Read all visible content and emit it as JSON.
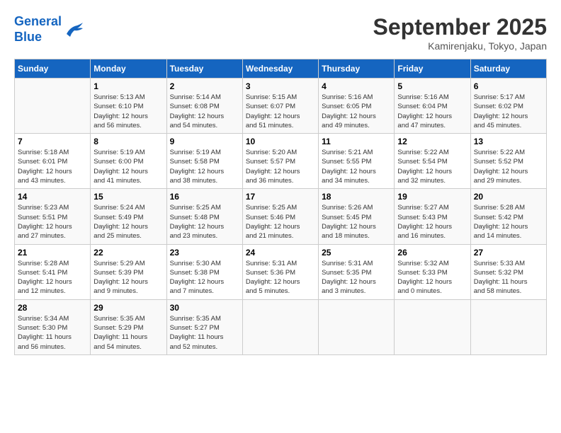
{
  "header": {
    "logo_line1": "General",
    "logo_line2": "Blue",
    "month": "September 2025",
    "location": "Kamirenjaku, Tokyo, Japan"
  },
  "weekdays": [
    "Sunday",
    "Monday",
    "Tuesday",
    "Wednesday",
    "Thursday",
    "Friday",
    "Saturday"
  ],
  "weeks": [
    [
      {
        "num": "",
        "info": ""
      },
      {
        "num": "1",
        "info": "Sunrise: 5:13 AM\nSunset: 6:10 PM\nDaylight: 12 hours\nand 56 minutes."
      },
      {
        "num": "2",
        "info": "Sunrise: 5:14 AM\nSunset: 6:08 PM\nDaylight: 12 hours\nand 54 minutes."
      },
      {
        "num": "3",
        "info": "Sunrise: 5:15 AM\nSunset: 6:07 PM\nDaylight: 12 hours\nand 51 minutes."
      },
      {
        "num": "4",
        "info": "Sunrise: 5:16 AM\nSunset: 6:05 PM\nDaylight: 12 hours\nand 49 minutes."
      },
      {
        "num": "5",
        "info": "Sunrise: 5:16 AM\nSunset: 6:04 PM\nDaylight: 12 hours\nand 47 minutes."
      },
      {
        "num": "6",
        "info": "Sunrise: 5:17 AM\nSunset: 6:02 PM\nDaylight: 12 hours\nand 45 minutes."
      }
    ],
    [
      {
        "num": "7",
        "info": "Sunrise: 5:18 AM\nSunset: 6:01 PM\nDaylight: 12 hours\nand 43 minutes."
      },
      {
        "num": "8",
        "info": "Sunrise: 5:19 AM\nSunset: 6:00 PM\nDaylight: 12 hours\nand 41 minutes."
      },
      {
        "num": "9",
        "info": "Sunrise: 5:19 AM\nSunset: 5:58 PM\nDaylight: 12 hours\nand 38 minutes."
      },
      {
        "num": "10",
        "info": "Sunrise: 5:20 AM\nSunset: 5:57 PM\nDaylight: 12 hours\nand 36 minutes."
      },
      {
        "num": "11",
        "info": "Sunrise: 5:21 AM\nSunset: 5:55 PM\nDaylight: 12 hours\nand 34 minutes."
      },
      {
        "num": "12",
        "info": "Sunrise: 5:22 AM\nSunset: 5:54 PM\nDaylight: 12 hours\nand 32 minutes."
      },
      {
        "num": "13",
        "info": "Sunrise: 5:22 AM\nSunset: 5:52 PM\nDaylight: 12 hours\nand 29 minutes."
      }
    ],
    [
      {
        "num": "14",
        "info": "Sunrise: 5:23 AM\nSunset: 5:51 PM\nDaylight: 12 hours\nand 27 minutes."
      },
      {
        "num": "15",
        "info": "Sunrise: 5:24 AM\nSunset: 5:49 PM\nDaylight: 12 hours\nand 25 minutes."
      },
      {
        "num": "16",
        "info": "Sunrise: 5:25 AM\nSunset: 5:48 PM\nDaylight: 12 hours\nand 23 minutes."
      },
      {
        "num": "17",
        "info": "Sunrise: 5:25 AM\nSunset: 5:46 PM\nDaylight: 12 hours\nand 21 minutes."
      },
      {
        "num": "18",
        "info": "Sunrise: 5:26 AM\nSunset: 5:45 PM\nDaylight: 12 hours\nand 18 minutes."
      },
      {
        "num": "19",
        "info": "Sunrise: 5:27 AM\nSunset: 5:43 PM\nDaylight: 12 hours\nand 16 minutes."
      },
      {
        "num": "20",
        "info": "Sunrise: 5:28 AM\nSunset: 5:42 PM\nDaylight: 12 hours\nand 14 minutes."
      }
    ],
    [
      {
        "num": "21",
        "info": "Sunrise: 5:28 AM\nSunset: 5:41 PM\nDaylight: 12 hours\nand 12 minutes."
      },
      {
        "num": "22",
        "info": "Sunrise: 5:29 AM\nSunset: 5:39 PM\nDaylight: 12 hours\nand 9 minutes."
      },
      {
        "num": "23",
        "info": "Sunrise: 5:30 AM\nSunset: 5:38 PM\nDaylight: 12 hours\nand 7 minutes."
      },
      {
        "num": "24",
        "info": "Sunrise: 5:31 AM\nSunset: 5:36 PM\nDaylight: 12 hours\nand 5 minutes."
      },
      {
        "num": "25",
        "info": "Sunrise: 5:31 AM\nSunset: 5:35 PM\nDaylight: 12 hours\nand 3 minutes."
      },
      {
        "num": "26",
        "info": "Sunrise: 5:32 AM\nSunset: 5:33 PM\nDaylight: 12 hours\nand 0 minutes."
      },
      {
        "num": "27",
        "info": "Sunrise: 5:33 AM\nSunset: 5:32 PM\nDaylight: 11 hours\nand 58 minutes."
      }
    ],
    [
      {
        "num": "28",
        "info": "Sunrise: 5:34 AM\nSunset: 5:30 PM\nDaylight: 11 hours\nand 56 minutes."
      },
      {
        "num": "29",
        "info": "Sunrise: 5:35 AM\nSunset: 5:29 PM\nDaylight: 11 hours\nand 54 minutes."
      },
      {
        "num": "30",
        "info": "Sunrise: 5:35 AM\nSunset: 5:27 PM\nDaylight: 11 hours\nand 52 minutes."
      },
      {
        "num": "",
        "info": ""
      },
      {
        "num": "",
        "info": ""
      },
      {
        "num": "",
        "info": ""
      },
      {
        "num": "",
        "info": ""
      }
    ]
  ]
}
